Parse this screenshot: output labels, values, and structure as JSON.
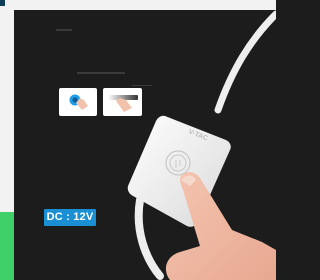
{
  "badge": {
    "text": "DC : 12V"
  },
  "device": {
    "brand": "V-TAC"
  },
  "colors": {
    "background": "#1c1c1c",
    "frame": "#f2f2f2",
    "accent_green": "#3fd06a",
    "badge_blue": "#1b8fd3",
    "touch_ring": "#1e9ee8"
  },
  "icons": [
    "touch-tap-icon",
    "touch-slide-icon",
    "touch-sensor-icon"
  ]
}
